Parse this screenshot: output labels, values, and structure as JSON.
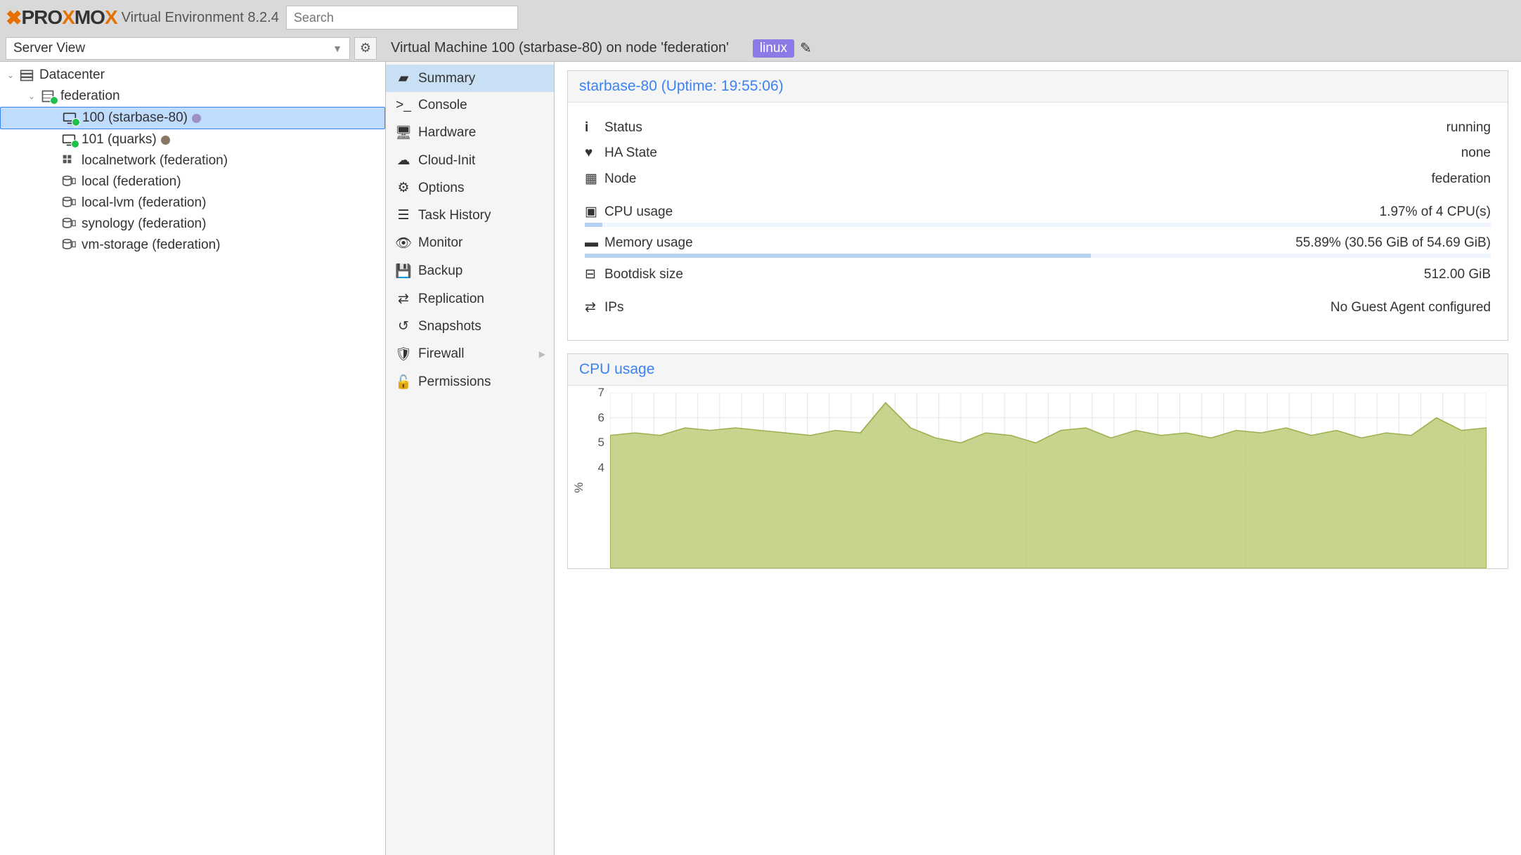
{
  "header": {
    "product": "PROXMOX",
    "subtitle": "Virtual Environment 8.2.4",
    "search_placeholder": "Search"
  },
  "toolbar": {
    "view_label": "Server View",
    "breadcrumb": "Virtual Machine 100 (starbase-80) on node 'federation'",
    "tag": "linux"
  },
  "tree": {
    "datacenter": "Datacenter",
    "node": "federation",
    "vm100": "100 (starbase-80)",
    "vm101": "101 (quarks)",
    "net": "localnetwork (federation)",
    "s_local": "local (federation)",
    "s_locallvm": "local-lvm (federation)",
    "s_syn": "synology (federation)",
    "s_vm": "vm-storage (federation)"
  },
  "sidemenu": {
    "summary": "Summary",
    "console": "Console",
    "hardware": "Hardware",
    "cloudinit": "Cloud-Init",
    "options": "Options",
    "taskhistory": "Task History",
    "monitor": "Monitor",
    "backup": "Backup",
    "replication": "Replication",
    "snapshots": "Snapshots",
    "firewall": "Firewall",
    "permissions": "Permissions"
  },
  "summary": {
    "title": "starbase-80 (Uptime: 19:55:06)",
    "status_label": "Status",
    "status_value": "running",
    "ha_label": "HA State",
    "ha_value": "none",
    "node_label": "Node",
    "node_value": "federation",
    "cpu_label": "CPU usage",
    "cpu_value": "1.97% of 4 CPU(s)",
    "mem_label": "Memory usage",
    "mem_value": "55.89% (30.56 GiB of 54.69 GiB)",
    "boot_label": "Bootdisk size",
    "boot_value": "512.00 GiB",
    "ips_label": "IPs",
    "ips_value": "No Guest Agent configured"
  },
  "chart_data": {
    "type": "area",
    "title": "CPU usage",
    "ylabel": "%",
    "ylim": [
      0,
      7
    ],
    "yticks": [
      4,
      5,
      6,
      7
    ],
    "x": [
      0,
      1,
      2,
      3,
      4,
      5,
      6,
      7,
      8,
      9,
      10,
      11,
      12,
      13,
      14,
      15,
      16,
      17,
      18,
      19,
      20,
      21,
      22,
      23,
      24,
      25,
      26,
      27,
      28,
      29,
      30,
      31,
      32,
      33,
      34,
      35
    ],
    "values": [
      5.3,
      5.4,
      5.3,
      5.6,
      5.5,
      5.6,
      5.5,
      5.4,
      5.3,
      5.5,
      5.4,
      6.6,
      5.6,
      5.2,
      5.0,
      5.4,
      5.3,
      5.0,
      5.5,
      5.6,
      5.2,
      5.5,
      5.3,
      5.4,
      5.2,
      5.5,
      5.4,
      5.6,
      5.3,
      5.5,
      5.2,
      5.4,
      5.3,
      6.0,
      5.5,
      5.6
    ]
  }
}
